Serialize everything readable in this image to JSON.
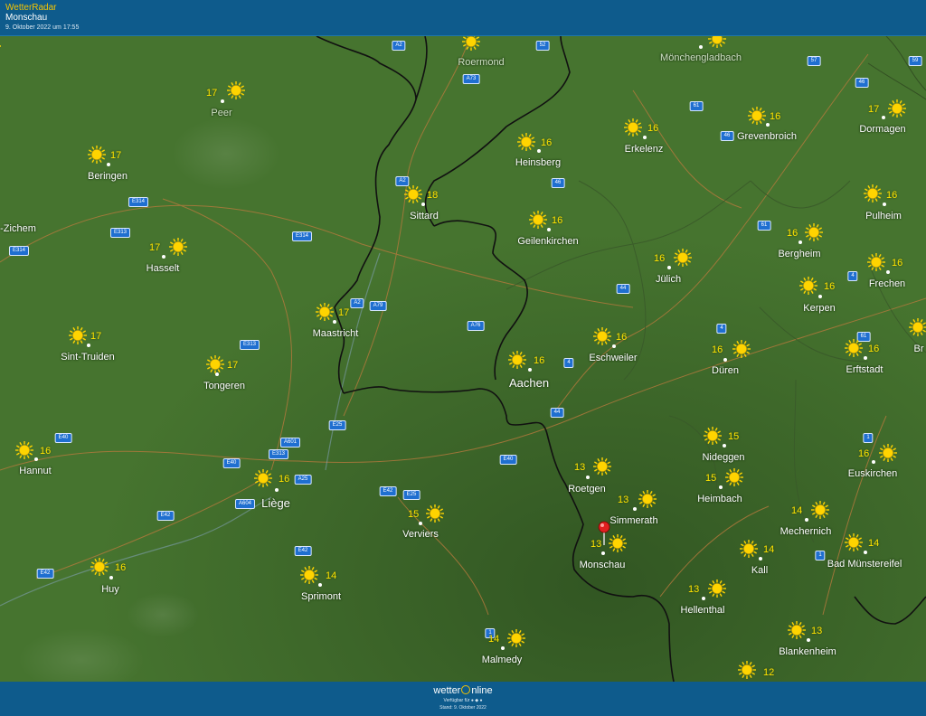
{
  "header": {
    "brand": "WetterRadar",
    "location": "Monschau",
    "timestamp": "9. Oktober 2022 um 17:55"
  },
  "footer": {
    "logo_left": "wetter",
    "logo_right": "nline",
    "available": "Verfügbar für",
    "stand": "Stand: 9. Oktober 2022"
  },
  "colors": {
    "land": "#46742f",
    "header": "#0e5b8c",
    "temperature": "#ffe400",
    "sun": "#ffd400",
    "border_line": "#111111",
    "road": "#b6793d",
    "pin": "#e02020"
  },
  "cities": [
    {
      "name": "Peer",
      "temp": "17",
      "dim": true
    },
    {
      "name": "Beringen",
      "temp": "17"
    },
    {
      "name": "Hasselt",
      "temp": "17"
    },
    {
      "name": "-Zichem",
      "temp": ""
    },
    {
      "name": "Sint-Truiden",
      "temp": "17"
    },
    {
      "name": "Tongeren",
      "temp": "17"
    },
    {
      "name": "Hannut",
      "temp": "16"
    },
    {
      "name": "Liège",
      "temp": "16",
      "big": true
    },
    {
      "name": "Huy",
      "temp": "16"
    },
    {
      "name": "Sprimont",
      "temp": "14"
    },
    {
      "name": "Verviers",
      "temp": "15"
    },
    {
      "name": "Malmedy",
      "temp": "14"
    },
    {
      "name": "Maastricht",
      "temp": "17"
    },
    {
      "name": "Sittard",
      "temp": "18"
    },
    {
      "name": "Roermond",
      "temp": "",
      "dim": true
    },
    {
      "name": "Heinsberg",
      "temp": "16"
    },
    {
      "name": "Geilenkirchen",
      "temp": "16"
    },
    {
      "name": "Erkelenz",
      "temp": "16"
    },
    {
      "name": "Mönchengladbach",
      "temp": "",
      "dim": true
    },
    {
      "name": "Grevenbroich",
      "temp": "16"
    },
    {
      "name": "Dormagen",
      "temp": "17"
    },
    {
      "name": "Pulheim",
      "temp": "16"
    },
    {
      "name": "Bergheim",
      "temp": "16"
    },
    {
      "name": "Frechen",
      "temp": "16"
    },
    {
      "name": "Kerpen",
      "temp": "16"
    },
    {
      "name": "Jülich",
      "temp": "16"
    },
    {
      "name": "Aachen",
      "temp": "16",
      "big": true
    },
    {
      "name": "Eschweiler",
      "temp": "16"
    },
    {
      "name": "Düren",
      "temp": "16"
    },
    {
      "name": "Erftstadt",
      "temp": "16"
    },
    {
      "name": "Br",
      "temp": ""
    },
    {
      "name": "Nideggen",
      "temp": "15"
    },
    {
      "name": "Heimbach",
      "temp": "15"
    },
    {
      "name": "Euskirchen",
      "temp": "16"
    },
    {
      "name": "Roetgen",
      "temp": "13"
    },
    {
      "name": "Simmerath",
      "temp": "13"
    },
    {
      "name": "Monschau",
      "temp": "13"
    },
    {
      "name": "Mechernich",
      "temp": "14"
    },
    {
      "name": "Kall",
      "temp": "14"
    },
    {
      "name": "Bad Münstereifel",
      "temp": "14"
    },
    {
      "name": "Hellenthal",
      "temp": "13"
    },
    {
      "name": "Blankenheim",
      "temp": "13"
    },
    {
      "name": "",
      "temp": "12"
    }
  ],
  "roads": [
    "A2",
    "A73",
    "52",
    "57",
    "59",
    "46",
    "61",
    "46",
    "46",
    "A2",
    "E314",
    "E313",
    "E314",
    "E314",
    "A2",
    "A79",
    "44",
    "A76",
    "61",
    "4",
    "4",
    "61",
    "4",
    "E313",
    "E25",
    "44",
    "E40",
    "A601",
    "E313",
    "E40",
    "A25",
    "E40",
    "E42",
    "A604",
    "E42",
    "E25",
    "E42",
    "E42",
    "1",
    "1",
    "1"
  ],
  "icons": {
    "weather": "sun-icon",
    "marker": "location-pin-icon",
    "platforms": "apple-android-icons"
  }
}
